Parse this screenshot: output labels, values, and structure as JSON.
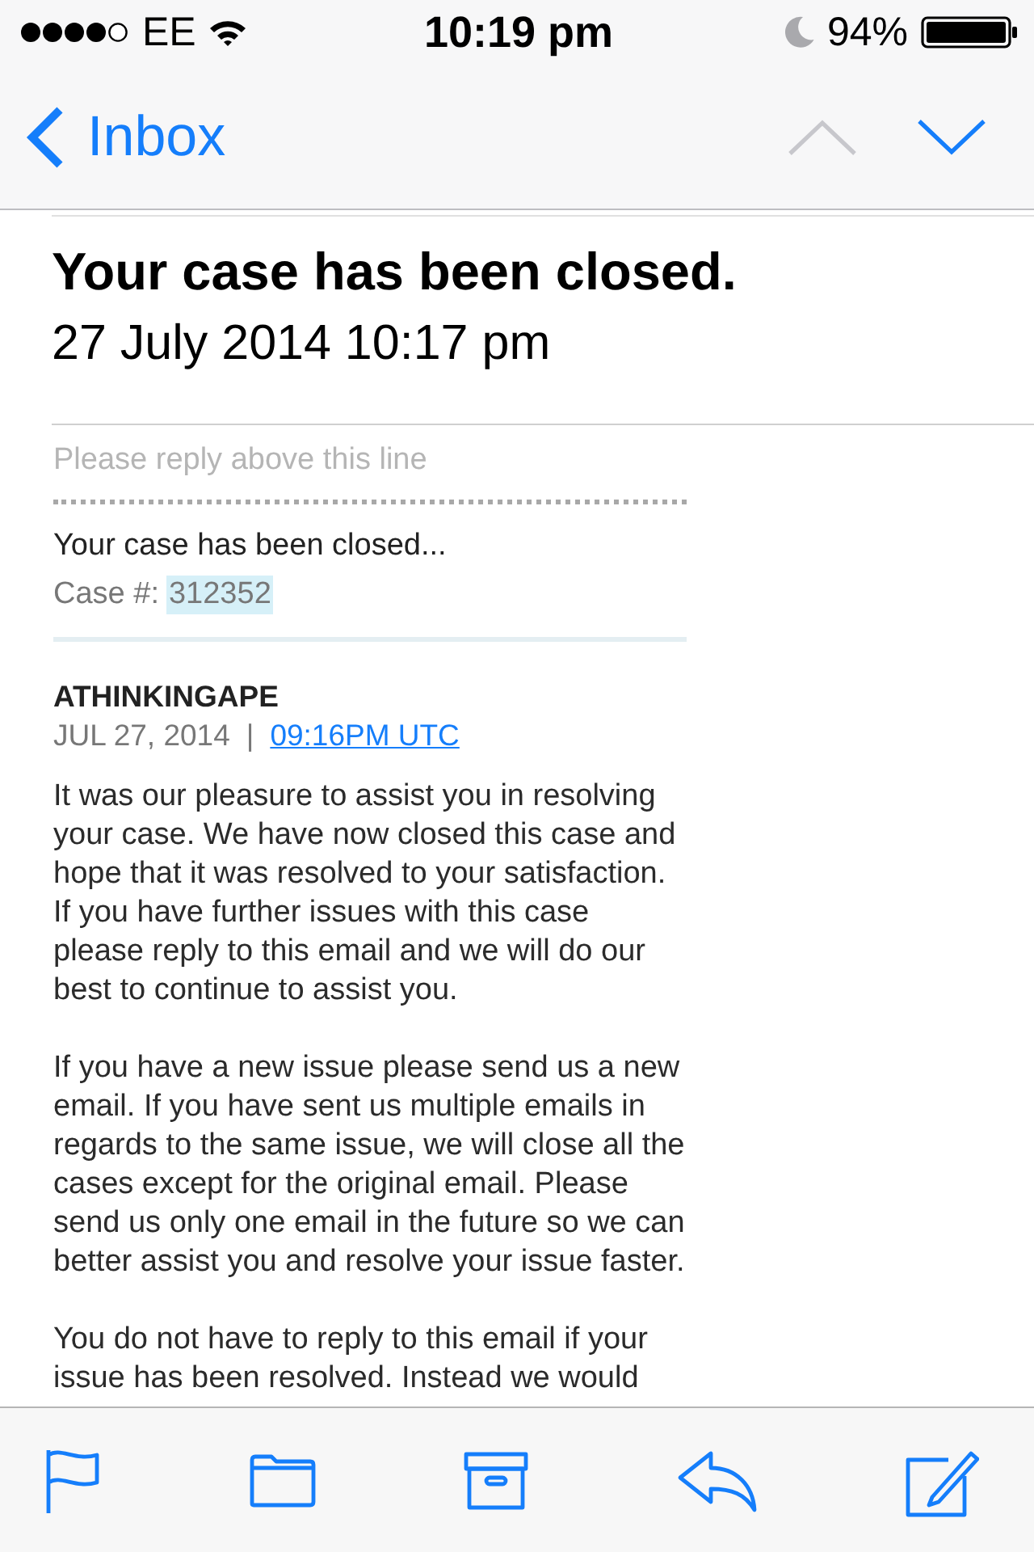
{
  "status_bar": {
    "carrier": "EE",
    "time": "10:19 pm",
    "battery": "94%"
  },
  "nav": {
    "back_label": "Inbox",
    "previous": {
      "disabled": true
    },
    "next": {
      "disabled": false
    }
  },
  "message": {
    "subject": "Your case has been closed.",
    "date": "27 July 2014 10:17 pm"
  },
  "body": {
    "reply_hint": "Please reply above this line",
    "summary": "Your case has been closed...",
    "case_label": "Case #:",
    "case_number": "312352",
    "case_number_highlighted": true,
    "sender": "ATHINKINGAPE",
    "sent_date": "JUL 27, 2014",
    "separator": "|",
    "sent_time_link": "09:16PM UTC",
    "paragraphs": [
      "It was our pleasure to assist you in resolving your case. We have now closed this case and hope that it was resolved to your satisfaction. If you have further issues with this case please reply to this email and we will do our best to continue to assist you.",
      "If you have a new issue please send us a new email. If you have sent us multiple emails in regards to the same issue, we will close all the cases except for the original email. Please send us only one email in the future so we can better assist you and resolve your issue faster.",
      "You do not have to reply to this email if your issue has been resolved. Instead we would"
    ]
  },
  "toolbar": [
    {
      "kind": "flag"
    },
    {
      "kind": "folder"
    },
    {
      "kind": "archive"
    },
    {
      "kind": "reply"
    },
    {
      "kind": "compose"
    }
  ]
}
